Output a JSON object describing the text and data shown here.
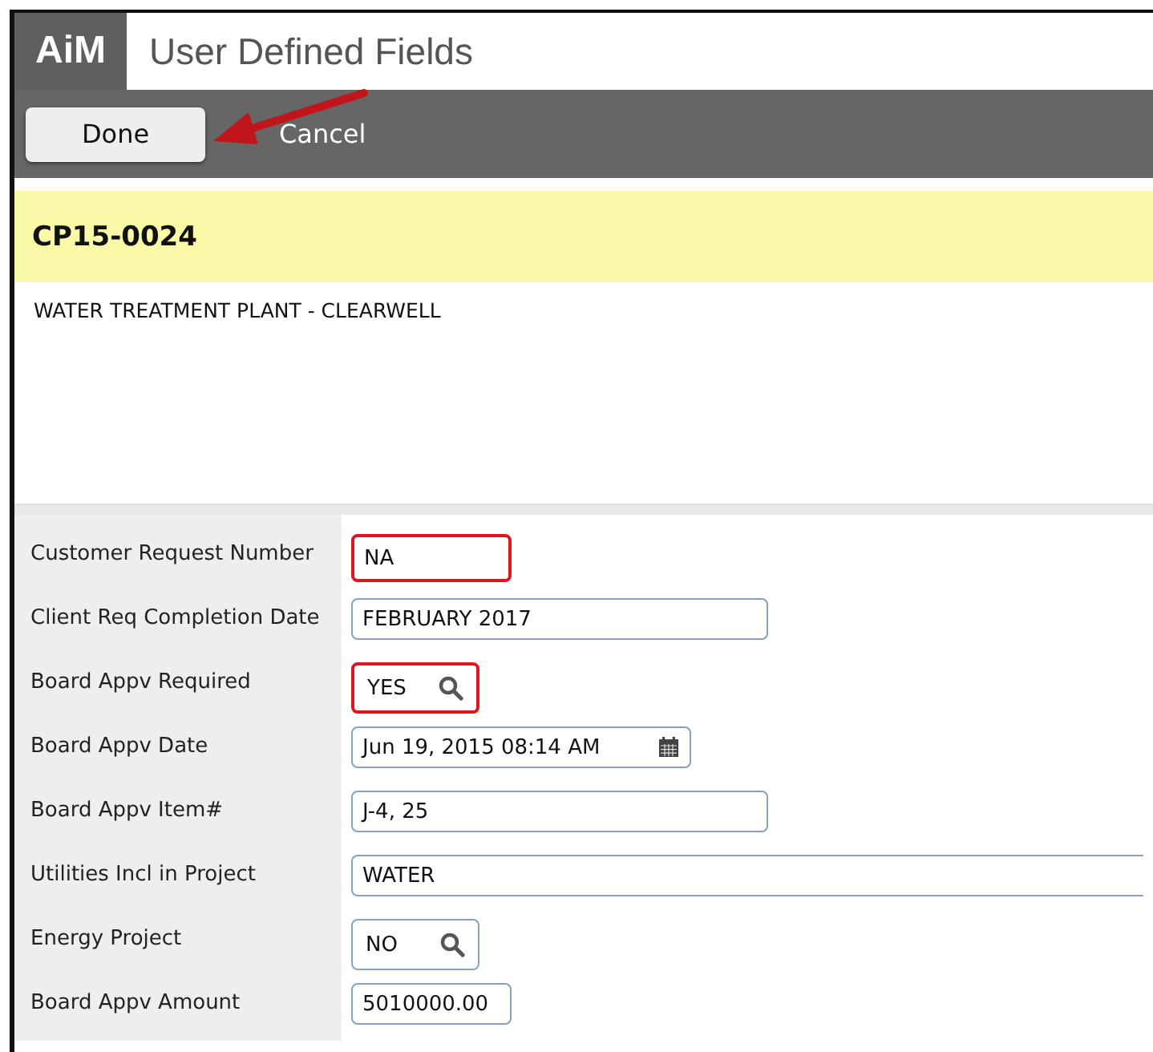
{
  "app": {
    "logo": "AiM",
    "title": "User Defined Fields"
  },
  "toolbar": {
    "buttons": [
      {
        "label": "Done",
        "kind": "primary"
      },
      {
        "label": "Cancel",
        "kind": "plain"
      }
    ]
  },
  "record": {
    "id": "CP15-0024",
    "description": "WATER TREATMENT PLANT - CLEARWELL"
  },
  "fields": [
    {
      "label": "Customer Request Number",
      "value": "NA",
      "kind": "text",
      "highlighted": true
    },
    {
      "label": "Client Req Completion Date",
      "value": "FEBRUARY 2017",
      "kind": "text",
      "highlighted": false
    },
    {
      "label": "Board Appv Required",
      "value": "YES",
      "kind": "lookup",
      "highlighted": true
    },
    {
      "label": "Board Appv Date",
      "value": "Jun 19, 2015 08:14 AM",
      "kind": "date",
      "highlighted": false
    },
    {
      "label": "Board Appv Item#",
      "value": "J-4, 25",
      "kind": "text",
      "highlighted": false
    },
    {
      "label": "Utilities Incl in Project",
      "value": "WATER",
      "kind": "text",
      "highlighted": false
    },
    {
      "label": "Energy Project",
      "value": "NO",
      "kind": "lookup",
      "highlighted": false
    },
    {
      "label": "Board Appv Amount",
      "value": "5010000.00",
      "kind": "text",
      "highlighted": false
    }
  ]
}
